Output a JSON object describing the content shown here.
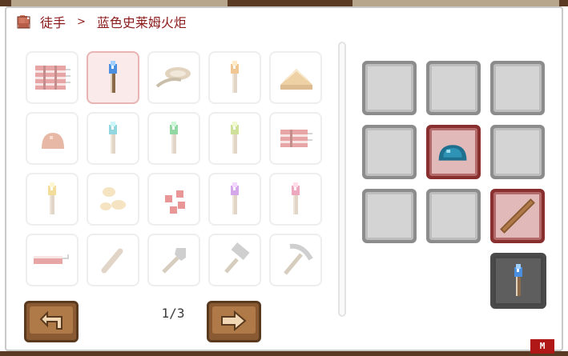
{
  "breadcrumb": {
    "root": "徒手",
    "separator": ">",
    "current": "蓝色史莱姆火炬"
  },
  "recipes": [
    {
      "icon": "red-dynamite-bundle-icon",
      "selected": false
    },
    {
      "icon": "blue-torch-icon",
      "selected": true
    },
    {
      "icon": "gear-rope-icon",
      "selected": false
    },
    {
      "icon": "orange-torch-icon",
      "selected": false
    },
    {
      "icon": "pie-icon",
      "selected": false
    },
    {
      "icon": "slime-lump-icon",
      "selected": false
    },
    {
      "icon": "cyan-torch-icon",
      "selected": false
    },
    {
      "icon": "green-torch-icon",
      "selected": false
    },
    {
      "icon": "lime-torch-icon",
      "selected": false
    },
    {
      "icon": "red-dynamite-icon",
      "selected": false
    },
    {
      "icon": "yellow-torch-icon",
      "selected": false
    },
    {
      "icon": "seeds-icon",
      "selected": false
    },
    {
      "icon": "red-berries-icon",
      "selected": false
    },
    {
      "icon": "purple-torch-icon",
      "selected": false
    },
    {
      "icon": "pink-torch-icon",
      "selected": false
    },
    {
      "icon": "red-dynamite-stick-icon",
      "selected": false
    },
    {
      "icon": "wood-stick-icon",
      "selected": false
    },
    {
      "icon": "shovel-icon",
      "selected": false
    },
    {
      "icon": "hammer-icon",
      "selected": false
    },
    {
      "icon": "pickaxe-icon",
      "selected": false
    }
  ],
  "crafting_slots": [
    {
      "icon": "",
      "filled": false
    },
    {
      "icon": "",
      "filled": false
    },
    {
      "icon": "",
      "filled": false
    },
    {
      "icon": "",
      "filled": false
    },
    {
      "icon": "blue-slime-gel-icon",
      "filled": true
    },
    {
      "icon": "",
      "filled": false
    },
    {
      "icon": "",
      "filled": false
    },
    {
      "icon": "",
      "filled": false
    },
    {
      "icon": "wood-stick-icon",
      "filled": true
    }
  ],
  "result": {
    "icon": "blue-torch-icon"
  },
  "pagination": {
    "label": "1/3"
  },
  "logo": {
    "text": "M"
  },
  "colors": {
    "breadcrumb": "#8a1a1a",
    "selected_cell": "#fbeaea",
    "filled_slot": "#8a2f2f",
    "button": "#b07a48"
  }
}
